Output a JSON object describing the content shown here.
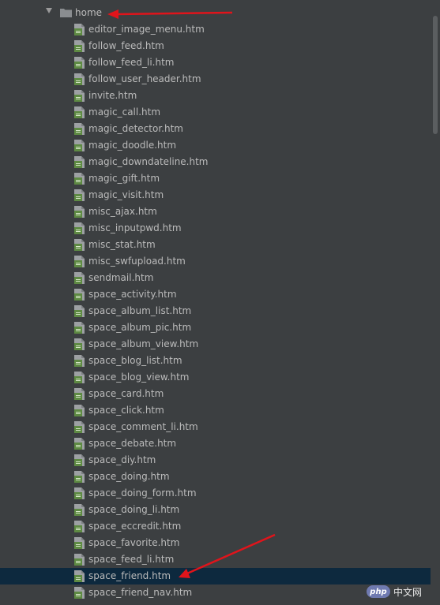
{
  "tree": {
    "folder": {
      "label": "home",
      "expanded": true
    },
    "files": [
      "editor_image_menu.htm",
      "follow_feed.htm",
      "follow_feed_li.htm",
      "follow_user_header.htm",
      "invite.htm",
      "magic_call.htm",
      "magic_detector.htm",
      "magic_doodle.htm",
      "magic_downdateline.htm",
      "magic_gift.htm",
      "magic_visit.htm",
      "misc_ajax.htm",
      "misc_inputpwd.htm",
      "misc_stat.htm",
      "misc_swfupload.htm",
      "sendmail.htm",
      "space_activity.htm",
      "space_album_list.htm",
      "space_album_pic.htm",
      "space_album_view.htm",
      "space_blog_list.htm",
      "space_blog_view.htm",
      "space_card.htm",
      "space_click.htm",
      "space_comment_li.htm",
      "space_debate.htm",
      "space_diy.htm",
      "space_doing.htm",
      "space_doing_form.htm",
      "space_doing_li.htm",
      "space_eccredit.htm",
      "space_favorite.htm",
      "space_feed_li.htm",
      "space_friend.htm",
      "space_friend_nav.htm"
    ],
    "selected_file": "space_friend.htm"
  },
  "colors": {
    "background": "#3c3f41",
    "selection": "#0d293e",
    "text": "#bbbbbb",
    "annotation_arrow": "#e0141b",
    "file_icon": "#5e8a43"
  },
  "icons": {
    "file": "html-file-icon",
    "folder": "folder-icon",
    "expand": "expand-arrow-icon"
  },
  "watermark": {
    "logo": "php",
    "text": "中文网"
  }
}
